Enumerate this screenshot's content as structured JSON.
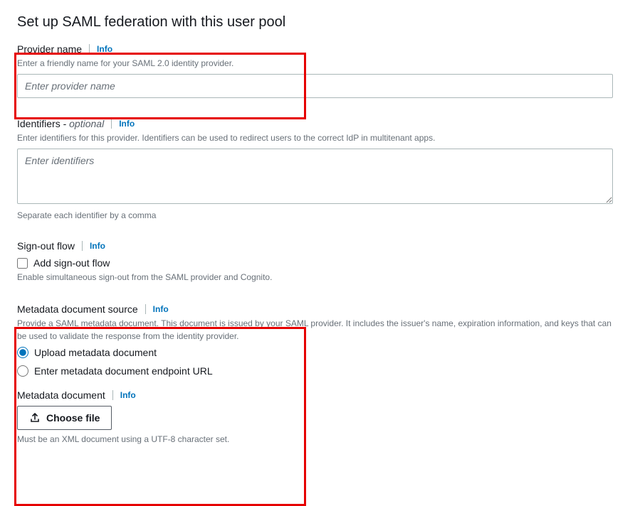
{
  "page": {
    "title": "Set up SAML federation with this user pool"
  },
  "info_label": "Info",
  "provider_name": {
    "label": "Provider name",
    "description": "Enter a friendly name for your SAML 2.0 identity provider.",
    "placeholder": "Enter provider name"
  },
  "identifiers": {
    "label": "Identifiers - ",
    "optional": "optional",
    "description": "Enter identifiers for this provider. Identifiers can be used to redirect users to the correct IdP in multitenant apps.",
    "placeholder": "Enter identifiers",
    "hint": "Separate each identifier by a comma"
  },
  "signout": {
    "label": "Sign-out flow",
    "checkbox_label": "Add sign-out flow",
    "description": "Enable simultaneous sign-out from the SAML provider and Cognito."
  },
  "metadata_source": {
    "label": "Metadata document source",
    "description": "Provide a SAML metadata document. This document is issued by your SAML provider. It includes the issuer's name, expiration information, and keys that can be used to validate the response from the identity provider.",
    "option_upload": "Upload metadata document",
    "option_url": "Enter metadata document endpoint URL"
  },
  "metadata_document": {
    "label": "Metadata document",
    "button": "Choose file",
    "hint": "Must be an XML document using a UTF-8 character set."
  }
}
